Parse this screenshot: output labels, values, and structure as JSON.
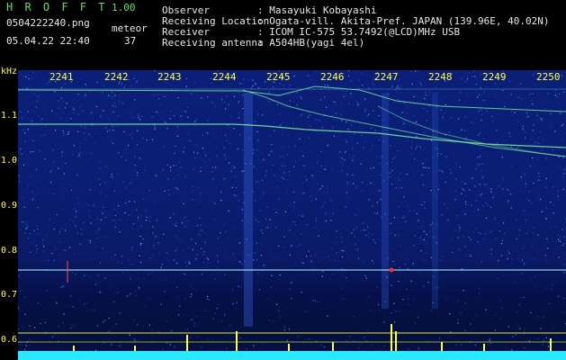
{
  "header": {
    "title": "H R O F F T",
    "version": "1.00",
    "file_name": "0504222240.png",
    "capture_time": "05.04.22 22:40",
    "meteor_label": "meteor",
    "meteor_count": "37",
    "info": [
      {
        "label": "Observer",
        "value": ": Masayuki Kobayashi"
      },
      {
        "label": "Receiving Location",
        "value": ": Ogata-vill. Akita-Pref. JAPAN (139.96E, 40.02N)"
      },
      {
        "label": "Receiver",
        "value": ": ICOM IC-575 53.7492(@LCD)MHz USB"
      },
      {
        "label": "Receiving antenna",
        "value": ": A504HB(yagi 4el)"
      }
    ]
  },
  "axes": {
    "y_unit": "kHz",
    "y_ticks": [
      "1.1",
      "1.0",
      "0.9",
      "0.8",
      "0.7",
      "0.6"
    ],
    "x_ticks": [
      "2241",
      "2242",
      "2243",
      "2244",
      "2245",
      "2246",
      "2247",
      "2248",
      "2249",
      "2250"
    ]
  },
  "colors": {
    "background": "#000000",
    "header_text": "#5ee05e",
    "axis_text": "#ffff3a",
    "info_text": "#e8e8e8",
    "spectrogram_base": "#0a1e74",
    "signal": "#7cf2a0",
    "baseline": "#29e8ff",
    "spike": "#ffff3a",
    "meteor_marker": "#ff3030"
  }
}
